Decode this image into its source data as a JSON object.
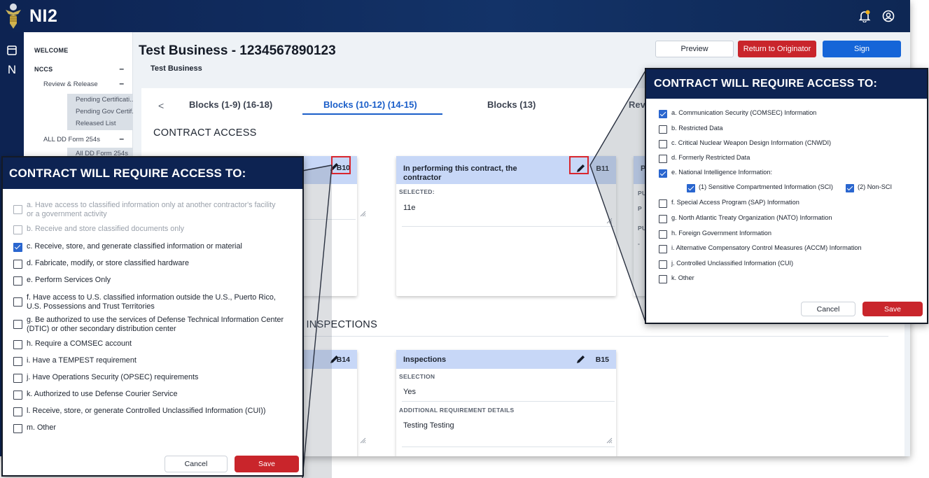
{
  "app": {
    "name": "NI2"
  },
  "sidebar": {
    "welcome": "WELCOME",
    "nccs": "NCCS",
    "review_release": "Review & Release",
    "review_items": [
      "Pending Certificati...",
      "Pending Gov Certif...",
      "Released List"
    ],
    "all_forms": "ALL DD Form 254s",
    "all_forms_item": "All DD Form 254s",
    "rail_letter": "N"
  },
  "page": {
    "title": "Test Business - 1234567890123",
    "subtitle": "Test Business"
  },
  "actions": {
    "preview": "Preview",
    "return": "Return to Originator",
    "sign": "Sign"
  },
  "tabs": {
    "prev": "<",
    "items": [
      "Blocks (1-9) (16-18)",
      "Blocks (10-12) (14-15)",
      "Blocks (13)",
      "Rev"
    ]
  },
  "sections": {
    "contract_access": "CONTRACT ACCESS",
    "inspections": ") INSPECTIONS"
  },
  "cards": {
    "b10_code": "B10",
    "b11": {
      "title": "In performing this contract, the contractor",
      "code": "B11",
      "label": "SELECTED:",
      "value": "11e"
    },
    "b12_fragment": {
      "title": "P",
      "labels": [
        "PU",
        "P",
        "PU",
        "-"
      ]
    },
    "b14_code": "B14",
    "b15": {
      "title": "Inspections",
      "code": "B15",
      "selection_label": "SELECTION",
      "selection_value": "Yes",
      "details_label": "ADDITIONAL REQUIREMENT DETAILS",
      "details_value": "Testing Testing"
    }
  },
  "popup_left": {
    "title": "CONTRACT WILL REQUIRE ACCESS TO:",
    "options": [
      {
        "text": "a. Have access to classified information only at another contractor's facility",
        "text2": "or a government activity",
        "state": "disabled"
      },
      {
        "text": "b. Receive and store classified documents only",
        "state": "disabled"
      },
      {
        "text": "c. Receive, store, and generate classified information or material",
        "state": "checked"
      },
      {
        "text": "d. Fabricate, modify, or store classified hardware",
        "state": "unchecked"
      },
      {
        "text": "e. Perform Services Only",
        "state": "unchecked"
      },
      {
        "text": "f. Have access to U.S. classified information outside the U.S., Puerto Rico,",
        "text2": "U.S. Possessions and Trust Territories",
        "state": "unchecked"
      },
      {
        "text": "g. Be authorized to use the services of Defense Technical Information Center",
        "text2": "(DTIC) or other secondary distribution center",
        "state": "unchecked"
      },
      {
        "text": "h. Require a COMSEC account",
        "state": "unchecked"
      },
      {
        "text": "i. Have a TEMPEST requirement",
        "state": "unchecked"
      },
      {
        "text": "j. Have Operations Security (OPSEC) requirements",
        "state": "unchecked"
      },
      {
        "text": "k. Authorized to use Defense Courier Service",
        "state": "unchecked"
      },
      {
        "text": "l. Receive, store, or generate Controlled Unclassified Information (CUI))",
        "state": "unchecked"
      },
      {
        "text": "m. Other",
        "state": "unchecked"
      }
    ],
    "cancel": "Cancel",
    "save": "Save"
  },
  "popup_right": {
    "title": "CONTRACT WILL REQUIRE ACCESS TO:",
    "options": [
      {
        "text": "a. Communication Security (COMSEC) Information",
        "state": "checked"
      },
      {
        "text": "b. Restricted Data",
        "state": "unchecked"
      },
      {
        "text": "c. Critical Nuclear Weapon Design Information (CNWDI)",
        "state": "unchecked"
      },
      {
        "text": "d. Formerly Restricted Data",
        "state": "unchecked"
      },
      {
        "text": "e. National Intelligence Information:",
        "state": "checked"
      },
      {
        "text": "f. Special Access Program (SAP) Information",
        "state": "unchecked"
      },
      {
        "text": "g. North Atlantic Treaty Organization (NATO) Information",
        "state": "unchecked"
      },
      {
        "text": "h. Foreign Government Information",
        "state": "unchecked"
      },
      {
        "text": "i. Alternative Compensatory Control Measures (ACCM) Information",
        "state": "unchecked"
      },
      {
        "text": "j. Controlled Unclassified Information (CUI)",
        "state": "unchecked"
      },
      {
        "text": "k. Other",
        "state": "unchecked"
      }
    ],
    "sub_options": [
      {
        "text": "(1) Sensitive Compartmented Information (SCI)",
        "state": "checked"
      },
      {
        "text": "(2) Non-SCI",
        "state": "checked"
      }
    ],
    "cancel": "Cancel",
    "save": "Save"
  },
  "colors": {
    "navy": "#0d2352",
    "accent_blue": "#1565d8",
    "danger_red": "#c9252b",
    "card_header": "#c7d7f7"
  }
}
